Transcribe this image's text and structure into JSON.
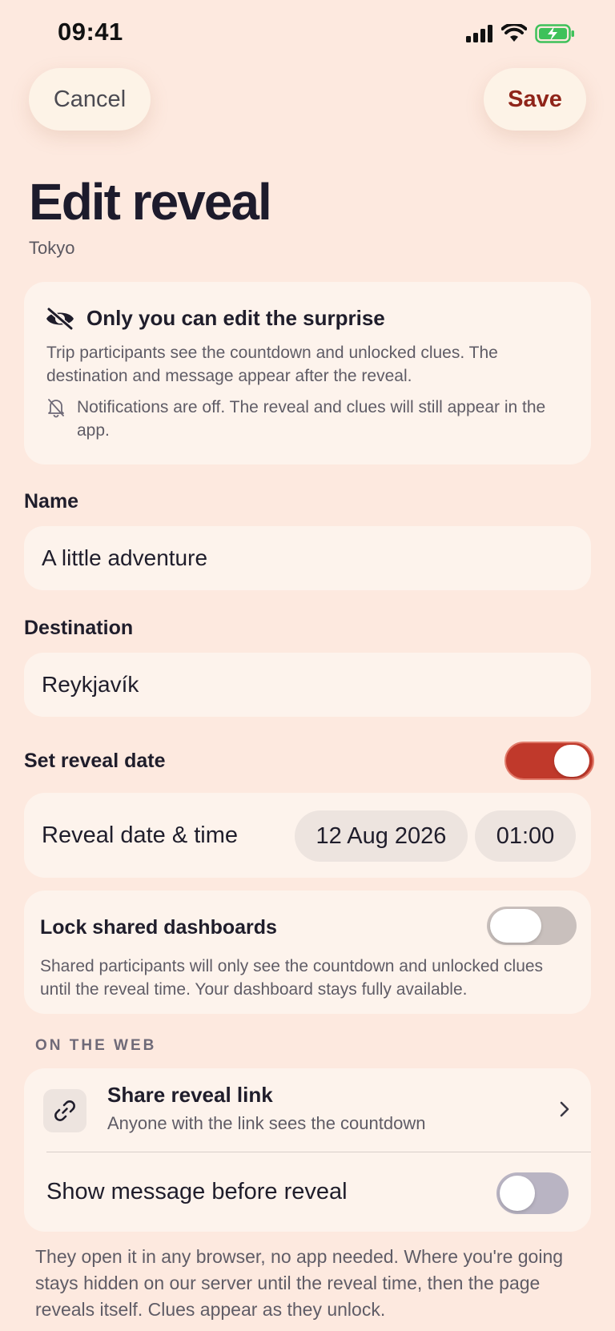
{
  "status_bar": {
    "time": "09:41"
  },
  "nav": {
    "cancel_label": "Cancel",
    "save_label": "Save"
  },
  "header": {
    "title": "Edit reveal",
    "subtitle": "Tokyo"
  },
  "privacy_card": {
    "heading": "Only you can edit the surprise",
    "body": "Trip participants see the countdown and unlocked clues. The destination and message appear after the reveal.",
    "notification_note": "Notifications are off. The reveal and clues will still appear in the app."
  },
  "name_field": {
    "label": "Name",
    "value": "A little adventure"
  },
  "destination_field": {
    "label": "Destination",
    "value": "Reykjavík"
  },
  "reveal_date_toggle": {
    "label": "Set reveal date",
    "on": true
  },
  "reveal_datetime": {
    "label": "Reveal date & time",
    "date": "12 Aug 2026",
    "time": "01:00"
  },
  "lock_dashboards": {
    "label": "Lock shared dashboards",
    "on": false,
    "description": "Shared participants will only see the countdown and unlocked clues until the reveal time. Your dashboard stays fully available."
  },
  "web_section": {
    "title": "ON THE WEB",
    "share_link": {
      "title": "Share reveal link",
      "subtitle": "Anyone with the link sees the countdown"
    },
    "show_message": {
      "label": "Show message before reveal",
      "on": false
    }
  },
  "footer_text": "They open it in any browser, no app needed. Where you're going stays hidden on our server until the reveal time, then the page reveals itself. Clues appear as they unlock.",
  "colors": {
    "accent": "#c0392b",
    "save_text": "#8f2419",
    "background": "#fde9df",
    "card": "#fdf3ec"
  },
  "icons": [
    "signal-icon",
    "wifi-icon",
    "battery-charging-icon",
    "eye-off-icon",
    "bell-off-icon",
    "link-icon",
    "chevron-right-icon"
  ]
}
